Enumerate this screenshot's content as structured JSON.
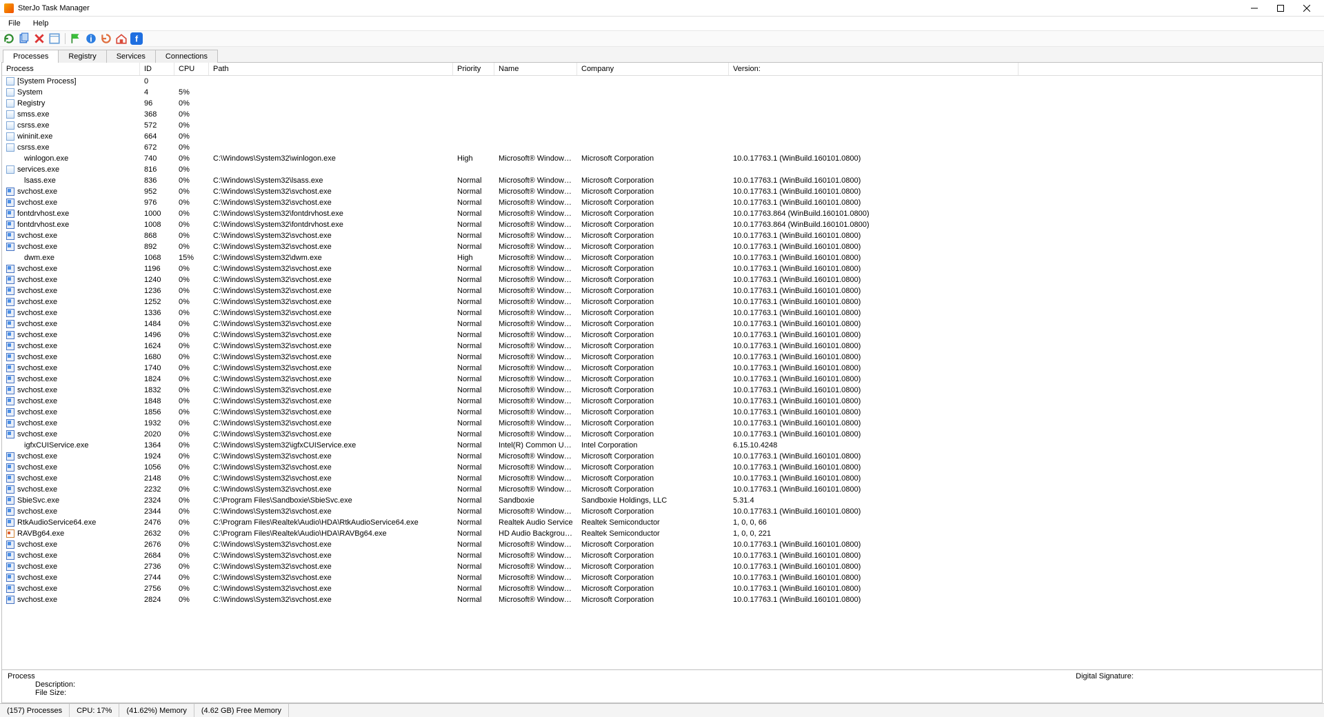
{
  "title": "SterJo Task Manager",
  "menus": [
    "File",
    "Help"
  ],
  "tabs": [
    "Processes",
    "Registry",
    "Services",
    "Connections"
  ],
  "active_tab": 0,
  "columns": [
    "Process",
    "ID",
    "CPU",
    "Path",
    "Priority",
    "Name",
    "Company",
    "Version:"
  ],
  "detail": {
    "process_label": "Process",
    "description_label": "Description:",
    "filesize_label": "File Size:",
    "sig_label": "Digital Signature:"
  },
  "status": {
    "processes": "(157) Processes",
    "cpu": "CPU: 17%",
    "memory": "(41.62%) Memory",
    "free": "(4.62 GB) Free Memory"
  },
  "rows": [
    {
      "icon": "sys",
      "indent": false,
      "process": "[System Process]",
      "id": "0",
      "cpu": "",
      "path": "",
      "prio": "",
      "name": "",
      "company": "",
      "version": ""
    },
    {
      "icon": "sys",
      "indent": false,
      "process": "System",
      "id": "4",
      "cpu": "5%",
      "path": "",
      "prio": "",
      "name": "",
      "company": "",
      "version": ""
    },
    {
      "icon": "sys",
      "indent": false,
      "process": "Registry",
      "id": "96",
      "cpu": "0%",
      "path": "",
      "prio": "",
      "name": "",
      "company": "",
      "version": ""
    },
    {
      "icon": "sys",
      "indent": false,
      "process": "smss.exe",
      "id": "368",
      "cpu": "0%",
      "path": "",
      "prio": "",
      "name": "",
      "company": "",
      "version": ""
    },
    {
      "icon": "sys",
      "indent": false,
      "process": "csrss.exe",
      "id": "572",
      "cpu": "0%",
      "path": "",
      "prio": "",
      "name": "",
      "company": "",
      "version": ""
    },
    {
      "icon": "sys",
      "indent": false,
      "process": "wininit.exe",
      "id": "664",
      "cpu": "0%",
      "path": "",
      "prio": "",
      "name": "",
      "company": "",
      "version": ""
    },
    {
      "icon": "sys",
      "indent": false,
      "process": "csrss.exe",
      "id": "672",
      "cpu": "0%",
      "path": "",
      "prio": "",
      "name": "",
      "company": "",
      "version": ""
    },
    {
      "icon": "none",
      "indent": true,
      "process": "winlogon.exe",
      "id": "740",
      "cpu": "0%",
      "path": "C:\\Windows\\System32\\winlogon.exe",
      "prio": "High",
      "name": "Microsoft® Windows® Ope...",
      "company": "Microsoft Corporation",
      "version": "10.0.17763.1 (WinBuild.160101.0800)"
    },
    {
      "icon": "sys",
      "indent": false,
      "process": "services.exe",
      "id": "816",
      "cpu": "0%",
      "path": "",
      "prio": "",
      "name": "",
      "company": "",
      "version": ""
    },
    {
      "icon": "none",
      "indent": true,
      "process": "lsass.exe",
      "id": "836",
      "cpu": "0%",
      "path": "C:\\Windows\\System32\\lsass.exe",
      "prio": "Normal",
      "name": "Microsoft® Windows® Ope...",
      "company": "Microsoft Corporation",
      "version": "10.0.17763.1 (WinBuild.160101.0800)"
    },
    {
      "icon": "app",
      "indent": false,
      "process": "svchost.exe",
      "id": "952",
      "cpu": "0%",
      "path": "C:\\Windows\\System32\\svchost.exe",
      "prio": "Normal",
      "name": "Microsoft® Windows® Ope...",
      "company": "Microsoft Corporation",
      "version": "10.0.17763.1 (WinBuild.160101.0800)"
    },
    {
      "icon": "app",
      "indent": false,
      "process": "svchost.exe",
      "id": "976",
      "cpu": "0%",
      "path": "C:\\Windows\\System32\\svchost.exe",
      "prio": "Normal",
      "name": "Microsoft® Windows® Ope...",
      "company": "Microsoft Corporation",
      "version": "10.0.17763.1 (WinBuild.160101.0800)"
    },
    {
      "icon": "app",
      "indent": false,
      "process": "fontdrvhost.exe",
      "id": "1000",
      "cpu": "0%",
      "path": "C:\\Windows\\System32\\fontdrvhost.exe",
      "prio": "Normal",
      "name": "Microsoft® Windows® Ope...",
      "company": "Microsoft Corporation",
      "version": "10.0.17763.864 (WinBuild.160101.0800)"
    },
    {
      "icon": "app",
      "indent": false,
      "process": "fontdrvhost.exe",
      "id": "1008",
      "cpu": "0%",
      "path": "C:\\Windows\\System32\\fontdrvhost.exe",
      "prio": "Normal",
      "name": "Microsoft® Windows® Ope...",
      "company": "Microsoft Corporation",
      "version": "10.0.17763.864 (WinBuild.160101.0800)"
    },
    {
      "icon": "app",
      "indent": false,
      "process": "svchost.exe",
      "id": "868",
      "cpu": "0%",
      "path": "C:\\Windows\\System32\\svchost.exe",
      "prio": "Normal",
      "name": "Microsoft® Windows® Ope...",
      "company": "Microsoft Corporation",
      "version": "10.0.17763.1 (WinBuild.160101.0800)"
    },
    {
      "icon": "app",
      "indent": false,
      "process": "svchost.exe",
      "id": "892",
      "cpu": "0%",
      "path": "C:\\Windows\\System32\\svchost.exe",
      "prio": "Normal",
      "name": "Microsoft® Windows® Ope...",
      "company": "Microsoft Corporation",
      "version": "10.0.17763.1 (WinBuild.160101.0800)"
    },
    {
      "icon": "none",
      "indent": true,
      "process": "dwm.exe",
      "id": "1068",
      "cpu": "15%",
      "path": "C:\\Windows\\System32\\dwm.exe",
      "prio": "High",
      "name": "Microsoft® Windows® Ope...",
      "company": "Microsoft Corporation",
      "version": "10.0.17763.1 (WinBuild.160101.0800)"
    },
    {
      "icon": "app",
      "indent": false,
      "process": "svchost.exe",
      "id": "1196",
      "cpu": "0%",
      "path": "C:\\Windows\\System32\\svchost.exe",
      "prio": "Normal",
      "name": "Microsoft® Windows® Ope...",
      "company": "Microsoft Corporation",
      "version": "10.0.17763.1 (WinBuild.160101.0800)"
    },
    {
      "icon": "app",
      "indent": false,
      "process": "svchost.exe",
      "id": "1240",
      "cpu": "0%",
      "path": "C:\\Windows\\System32\\svchost.exe",
      "prio": "Normal",
      "name": "Microsoft® Windows® Ope...",
      "company": "Microsoft Corporation",
      "version": "10.0.17763.1 (WinBuild.160101.0800)"
    },
    {
      "icon": "app",
      "indent": false,
      "process": "svchost.exe",
      "id": "1236",
      "cpu": "0%",
      "path": "C:\\Windows\\System32\\svchost.exe",
      "prio": "Normal",
      "name": "Microsoft® Windows® Ope...",
      "company": "Microsoft Corporation",
      "version": "10.0.17763.1 (WinBuild.160101.0800)"
    },
    {
      "icon": "app",
      "indent": false,
      "process": "svchost.exe",
      "id": "1252",
      "cpu": "0%",
      "path": "C:\\Windows\\System32\\svchost.exe",
      "prio": "Normal",
      "name": "Microsoft® Windows® Ope...",
      "company": "Microsoft Corporation",
      "version": "10.0.17763.1 (WinBuild.160101.0800)"
    },
    {
      "icon": "app",
      "indent": false,
      "process": "svchost.exe",
      "id": "1336",
      "cpu": "0%",
      "path": "C:\\Windows\\System32\\svchost.exe",
      "prio": "Normal",
      "name": "Microsoft® Windows® Ope...",
      "company": "Microsoft Corporation",
      "version": "10.0.17763.1 (WinBuild.160101.0800)"
    },
    {
      "icon": "app",
      "indent": false,
      "process": "svchost.exe",
      "id": "1484",
      "cpu": "0%",
      "path": "C:\\Windows\\System32\\svchost.exe",
      "prio": "Normal",
      "name": "Microsoft® Windows® Ope...",
      "company": "Microsoft Corporation",
      "version": "10.0.17763.1 (WinBuild.160101.0800)"
    },
    {
      "icon": "app",
      "indent": false,
      "process": "svchost.exe",
      "id": "1496",
      "cpu": "0%",
      "path": "C:\\Windows\\System32\\svchost.exe",
      "prio": "Normal",
      "name": "Microsoft® Windows® Ope...",
      "company": "Microsoft Corporation",
      "version": "10.0.17763.1 (WinBuild.160101.0800)"
    },
    {
      "icon": "app",
      "indent": false,
      "process": "svchost.exe",
      "id": "1624",
      "cpu": "0%",
      "path": "C:\\Windows\\System32\\svchost.exe",
      "prio": "Normal",
      "name": "Microsoft® Windows® Ope...",
      "company": "Microsoft Corporation",
      "version": "10.0.17763.1 (WinBuild.160101.0800)"
    },
    {
      "icon": "app",
      "indent": false,
      "process": "svchost.exe",
      "id": "1680",
      "cpu": "0%",
      "path": "C:\\Windows\\System32\\svchost.exe",
      "prio": "Normal",
      "name": "Microsoft® Windows® Ope...",
      "company": "Microsoft Corporation",
      "version": "10.0.17763.1 (WinBuild.160101.0800)"
    },
    {
      "icon": "app",
      "indent": false,
      "process": "svchost.exe",
      "id": "1740",
      "cpu": "0%",
      "path": "C:\\Windows\\System32\\svchost.exe",
      "prio": "Normal",
      "name": "Microsoft® Windows® Ope...",
      "company": "Microsoft Corporation",
      "version": "10.0.17763.1 (WinBuild.160101.0800)"
    },
    {
      "icon": "app",
      "indent": false,
      "process": "svchost.exe",
      "id": "1824",
      "cpu": "0%",
      "path": "C:\\Windows\\System32\\svchost.exe",
      "prio": "Normal",
      "name": "Microsoft® Windows® Ope...",
      "company": "Microsoft Corporation",
      "version": "10.0.17763.1 (WinBuild.160101.0800)"
    },
    {
      "icon": "app",
      "indent": false,
      "process": "svchost.exe",
      "id": "1832",
      "cpu": "0%",
      "path": "C:\\Windows\\System32\\svchost.exe",
      "prio": "Normal",
      "name": "Microsoft® Windows® Ope...",
      "company": "Microsoft Corporation",
      "version": "10.0.17763.1 (WinBuild.160101.0800)"
    },
    {
      "icon": "app",
      "indent": false,
      "process": "svchost.exe",
      "id": "1848",
      "cpu": "0%",
      "path": "C:\\Windows\\System32\\svchost.exe",
      "prio": "Normal",
      "name": "Microsoft® Windows® Ope...",
      "company": "Microsoft Corporation",
      "version": "10.0.17763.1 (WinBuild.160101.0800)"
    },
    {
      "icon": "app",
      "indent": false,
      "process": "svchost.exe",
      "id": "1856",
      "cpu": "0%",
      "path": "C:\\Windows\\System32\\svchost.exe",
      "prio": "Normal",
      "name": "Microsoft® Windows® Ope...",
      "company": "Microsoft Corporation",
      "version": "10.0.17763.1 (WinBuild.160101.0800)"
    },
    {
      "icon": "app",
      "indent": false,
      "process": "svchost.exe",
      "id": "1932",
      "cpu": "0%",
      "path": "C:\\Windows\\System32\\svchost.exe",
      "prio": "Normal",
      "name": "Microsoft® Windows® Ope...",
      "company": "Microsoft Corporation",
      "version": "10.0.17763.1 (WinBuild.160101.0800)"
    },
    {
      "icon": "app",
      "indent": false,
      "process": "svchost.exe",
      "id": "2020",
      "cpu": "0%",
      "path": "C:\\Windows\\System32\\svchost.exe",
      "prio": "Normal",
      "name": "Microsoft® Windows® Ope...",
      "company": "Microsoft Corporation",
      "version": "10.0.17763.1 (WinBuild.160101.0800)"
    },
    {
      "icon": "none",
      "indent": true,
      "process": "igfxCUIService.exe",
      "id": "1364",
      "cpu": "0%",
      "path": "C:\\Windows\\System32\\igfxCUIService.exe",
      "prio": "Normal",
      "name": "Intel(R) Common User Interf...",
      "company": "Intel Corporation",
      "version": "6.15.10.4248"
    },
    {
      "icon": "app",
      "indent": false,
      "process": "svchost.exe",
      "id": "1924",
      "cpu": "0%",
      "path": "C:\\Windows\\System32\\svchost.exe",
      "prio": "Normal",
      "name": "Microsoft® Windows® Ope...",
      "company": "Microsoft Corporation",
      "version": "10.0.17763.1 (WinBuild.160101.0800)"
    },
    {
      "icon": "app",
      "indent": false,
      "process": "svchost.exe",
      "id": "1056",
      "cpu": "0%",
      "path": "C:\\Windows\\System32\\svchost.exe",
      "prio": "Normal",
      "name": "Microsoft® Windows® Ope...",
      "company": "Microsoft Corporation",
      "version": "10.0.17763.1 (WinBuild.160101.0800)"
    },
    {
      "icon": "app",
      "indent": false,
      "process": "svchost.exe",
      "id": "2148",
      "cpu": "0%",
      "path": "C:\\Windows\\System32\\svchost.exe",
      "prio": "Normal",
      "name": "Microsoft® Windows® Ope...",
      "company": "Microsoft Corporation",
      "version": "10.0.17763.1 (WinBuild.160101.0800)"
    },
    {
      "icon": "app",
      "indent": false,
      "process": "svchost.exe",
      "id": "2232",
      "cpu": "0%",
      "path": "C:\\Windows\\System32\\svchost.exe",
      "prio": "Normal",
      "name": "Microsoft® Windows® Ope...",
      "company": "Microsoft Corporation",
      "version": "10.0.17763.1 (WinBuild.160101.0800)"
    },
    {
      "icon": "app",
      "indent": false,
      "process": "SbieSvc.exe",
      "id": "2324",
      "cpu": "0%",
      "path": "C:\\Program Files\\Sandboxie\\SbieSvc.exe",
      "prio": "Normal",
      "name": "Sandboxie",
      "company": "Sandboxie Holdings, LLC",
      "version": "5.31.4"
    },
    {
      "icon": "app",
      "indent": false,
      "process": "svchost.exe",
      "id": "2344",
      "cpu": "0%",
      "path": "C:\\Windows\\System32\\svchost.exe",
      "prio": "Normal",
      "name": "Microsoft® Windows® Ope...",
      "company": "Microsoft Corporation",
      "version": "10.0.17763.1 (WinBuild.160101.0800)"
    },
    {
      "icon": "app",
      "indent": false,
      "process": "RtkAudioService64.exe",
      "id": "2476",
      "cpu": "0%",
      "path": "C:\\Program Files\\Realtek\\Audio\\HDA\\RtkAudioService64.exe",
      "prio": "Normal",
      "name": "Realtek Audio Service",
      "company": "Realtek Semiconductor",
      "version": "1, 0, 0, 66"
    },
    {
      "icon": "snd",
      "indent": false,
      "process": "RAVBg64.exe",
      "id": "2632",
      "cpu": "0%",
      "path": "C:\\Program Files\\Realtek\\Audio\\HDA\\RAVBg64.exe",
      "prio": "Normal",
      "name": "HD Audio Background Pro...",
      "company": "Realtek Semiconductor",
      "version": "1, 0, 0, 221"
    },
    {
      "icon": "app",
      "indent": false,
      "process": "svchost.exe",
      "id": "2676",
      "cpu": "0%",
      "path": "C:\\Windows\\System32\\svchost.exe",
      "prio": "Normal",
      "name": "Microsoft® Windows® Ope...",
      "company": "Microsoft Corporation",
      "version": "10.0.17763.1 (WinBuild.160101.0800)"
    },
    {
      "icon": "app",
      "indent": false,
      "process": "svchost.exe",
      "id": "2684",
      "cpu": "0%",
      "path": "C:\\Windows\\System32\\svchost.exe",
      "prio": "Normal",
      "name": "Microsoft® Windows® Ope...",
      "company": "Microsoft Corporation",
      "version": "10.0.17763.1 (WinBuild.160101.0800)"
    },
    {
      "icon": "app",
      "indent": false,
      "process": "svchost.exe",
      "id": "2736",
      "cpu": "0%",
      "path": "C:\\Windows\\System32\\svchost.exe",
      "prio": "Normal",
      "name": "Microsoft® Windows® Ope...",
      "company": "Microsoft Corporation",
      "version": "10.0.17763.1 (WinBuild.160101.0800)"
    },
    {
      "icon": "app",
      "indent": false,
      "process": "svchost.exe",
      "id": "2744",
      "cpu": "0%",
      "path": "C:\\Windows\\System32\\svchost.exe",
      "prio": "Normal",
      "name": "Microsoft® Windows® Ope...",
      "company": "Microsoft Corporation",
      "version": "10.0.17763.1 (WinBuild.160101.0800)"
    },
    {
      "icon": "app",
      "indent": false,
      "process": "svchost.exe",
      "id": "2756",
      "cpu": "0%",
      "path": "C:\\Windows\\System32\\svchost.exe",
      "prio": "Normal",
      "name": "Microsoft® Windows® Ope...",
      "company": "Microsoft Corporation",
      "version": "10.0.17763.1 (WinBuild.160101.0800)"
    },
    {
      "icon": "app",
      "indent": false,
      "process": "svchost.exe",
      "id": "2824",
      "cpu": "0%",
      "path": "C:\\Windows\\System32\\svchost.exe",
      "prio": "Normal",
      "name": "Microsoft® Windows® Ope...",
      "company": "Microsoft Corporation",
      "version": "10.0.17763.1 (WinBuild.160101.0800)"
    }
  ]
}
